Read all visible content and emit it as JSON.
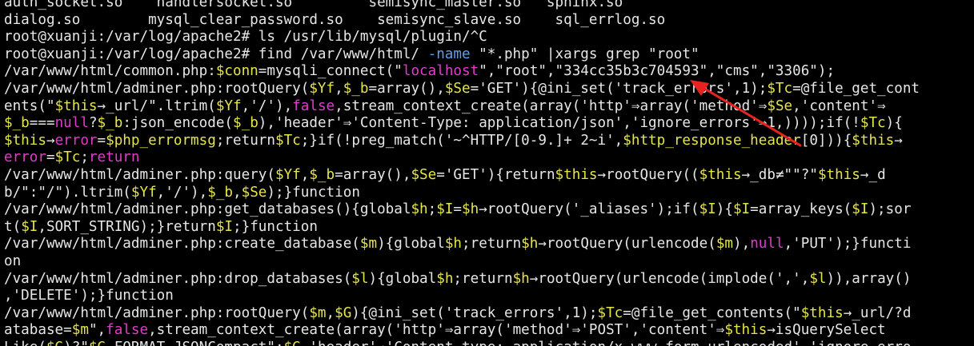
{
  "terminal": {
    "lines": [
      [
        [
          "auth_socket.so    handlersocket.so         semisync_master.so   sphinx.so",
          ""
        ]
      ],
      [
        [
          "dialog.so        mysql_clear_password.so    semisync_slave.so    sql_errlog.so",
          ""
        ]
      ],
      [
        [
          "root@xuanji:/var/log/apache2# ls /usr/lib/mysql/plugin/^C",
          ""
        ]
      ],
      [
        [
          "root@xuanji:/var/log/apache2# find /var/www/html/ ",
          ""
        ],
        [
          "-name",
          "opt"
        ],
        [
          " \"*.php\" |xargs grep \"root\"",
          ""
        ]
      ],
      [
        [
          "/var/www/html/common.php:",
          ""
        ],
        [
          "$conn",
          "var"
        ],
        [
          "=mysqli_connect(\"",
          ""
        ],
        [
          "localhost",
          "mag"
        ],
        [
          "\",\"root\",\"334cc35b3c704593\",\"cms\",\"3306\");",
          ""
        ]
      ],
      [
        [
          "/var/www/html/adminer.php:rootQuery(",
          ""
        ],
        [
          "$Yf",
          "var"
        ],
        [
          ",",
          ""
        ],
        [
          "$_b",
          "var"
        ],
        [
          "=array(),",
          ""
        ],
        [
          "$Se",
          "var"
        ],
        [
          "='GET'){@ini_set('track_errors',1);",
          ""
        ],
        [
          "$Tc",
          "var"
        ],
        [
          "=@file_get_cont",
          ""
        ]
      ],
      [
        [
          "ents(\"",
          ""
        ],
        [
          "$this",
          "var"
        ],
        [
          "→_url/\".ltrim(",
          ""
        ],
        [
          "$Yf",
          "var"
        ],
        [
          ",'/'),",
          ""
        ],
        [
          "false",
          "mag"
        ],
        [
          ",stream_context_create(array('http'⇒array('method'⇒",
          ""
        ],
        [
          "$Se",
          "var"
        ],
        [
          ",'content'⇒",
          ""
        ]
      ],
      [
        [
          "$_b",
          "var"
        ],
        [
          "===",
          ""
        ],
        [
          "null",
          "mag"
        ],
        [
          "?",
          ""
        ],
        [
          "$_b",
          "var"
        ],
        [
          ":json_encode(",
          ""
        ],
        [
          "$_b",
          "var"
        ],
        [
          "),'header'⇒'Content-Type: application/json','ignore_errors'⇒1,))));if(!",
          ""
        ],
        [
          "$Tc",
          "var"
        ],
        [
          "){",
          ""
        ]
      ],
      [
        [
          "$this",
          "var"
        ],
        [
          "→",
          ""
        ],
        [
          "error",
          "mag"
        ],
        [
          "=",
          ""
        ],
        [
          "$php_errormsg",
          "var"
        ],
        [
          ";return",
          ""
        ],
        [
          "$Tc",
          "var"
        ],
        [
          ";}if(!preg_match('~^HTTP/[0-9.]+ 2~i',",
          ""
        ],
        [
          "$http_response_header",
          "var"
        ],
        [
          "[0])){",
          ""
        ],
        [
          "$this",
          "var"
        ],
        [
          "→",
          ""
        ]
      ],
      [
        [
          "error",
          "mag"
        ],
        [
          "=",
          ""
        ],
        [
          "$Tc",
          "var"
        ],
        [
          ";",
          ""
        ],
        [
          "return",
          "mag"
        ]
      ],
      [
        [
          "/var/www/html/adminer.php:query(",
          ""
        ],
        [
          "$Yf",
          "var"
        ],
        [
          ",",
          ""
        ],
        [
          "$_b",
          "var"
        ],
        [
          "=array(),",
          ""
        ],
        [
          "$Se",
          "var"
        ],
        [
          "='GET'){return",
          ""
        ],
        [
          "$this",
          "var"
        ],
        [
          "→rootQuery((",
          ""
        ],
        [
          "$this",
          "var"
        ],
        [
          "→_db≠\"\"?\"",
          ""
        ],
        [
          "$this",
          "var"
        ],
        [
          "→_d",
          ""
        ]
      ],
      [
        [
          "b/\":\"/\").ltrim(",
          ""
        ],
        [
          "$Yf",
          "var"
        ],
        [
          ",'/'),",
          ""
        ],
        [
          "$_b",
          "var"
        ],
        [
          ",",
          ""
        ],
        [
          "$Se",
          "var"
        ],
        [
          ");}function",
          ""
        ]
      ],
      [
        [
          "/var/www/html/adminer.php:get_databases(){global",
          ""
        ],
        [
          "$h",
          "var"
        ],
        [
          ";",
          ""
        ],
        [
          "$I",
          "var"
        ],
        [
          "=",
          ""
        ],
        [
          "$h",
          "var"
        ],
        [
          "→rootQuery('_aliases');if(",
          ""
        ],
        [
          "$I",
          "var"
        ],
        [
          "){",
          ""
        ],
        [
          "$I",
          "var"
        ],
        [
          "=array_keys(",
          ""
        ],
        [
          "$I",
          "var"
        ],
        [
          ");sor",
          ""
        ]
      ],
      [
        [
          "t(",
          ""
        ],
        [
          "$I",
          "var"
        ],
        [
          ",SORT_STRING);}return",
          ""
        ],
        [
          "$I",
          "var"
        ],
        [
          ";}function",
          ""
        ]
      ],
      [
        [
          "/var/www/html/adminer.php:create_database(",
          ""
        ],
        [
          "$m",
          "var"
        ],
        [
          "){global",
          ""
        ],
        [
          "$h",
          "var"
        ],
        [
          ";return",
          ""
        ],
        [
          "$h",
          "var"
        ],
        [
          "→rootQuery(urlencode(",
          ""
        ],
        [
          "$m",
          "var"
        ],
        [
          "),",
          ""
        ],
        [
          "null",
          "mag"
        ],
        [
          ",'PUT');}functi",
          ""
        ]
      ],
      [
        [
          "on",
          ""
        ]
      ],
      [
        [
          "/var/www/html/adminer.php:drop_databases(",
          ""
        ],
        [
          "$l",
          "var"
        ],
        [
          "){global",
          ""
        ],
        [
          "$h",
          "var"
        ],
        [
          ";return",
          ""
        ],
        [
          "$h",
          "var"
        ],
        [
          "→rootQuery(urlencode(implode(',',",
          ""
        ],
        [
          "$l",
          "var"
        ],
        [
          ")),array()",
          ""
        ]
      ],
      [
        [
          ",'DELETE');}function",
          ""
        ]
      ],
      [
        [
          "/var/www/html/adminer.php:rootQuery(",
          ""
        ],
        [
          "$m",
          "var"
        ],
        [
          ",",
          ""
        ],
        [
          "$G",
          "var"
        ],
        [
          "){@ini_set('track_errors',1);",
          ""
        ],
        [
          "$Tc",
          "var"
        ],
        [
          "=@file_get_contents(\"",
          ""
        ],
        [
          "$this",
          "var"
        ],
        [
          "→_url/?d",
          ""
        ]
      ],
      [
        [
          "atabase=",
          ""
        ],
        [
          "$m",
          "var"
        ],
        [
          "\",",
          ""
        ],
        [
          "false",
          "mag"
        ],
        [
          ",stream_context_create(array('http'⇒array('method'⇒'POST','content'⇒",
          ""
        ],
        [
          "$this",
          "var"
        ],
        [
          "→isQuerySelect",
          ""
        ]
      ],
      [
        [
          "Like(",
          ""
        ],
        [
          "$G",
          "var"
        ],
        [
          ")?\"",
          ""
        ],
        [
          "$G",
          "var"
        ],
        [
          "_FORMAT_JSONCompact\":",
          ""
        ],
        [
          "$G",
          "var"
        ],
        [
          ",'header'⇒'Content-type: application/x-www-form-urlencoded','ignore_erro",
          ""
        ]
      ]
    ]
  },
  "colors": {
    "background": "#000000",
    "foreground": "#e6e6e6",
    "variable": "#e4e44b",
    "keyword": "#e03ccc",
    "option": "#5aa0f0",
    "annotation_arrow": "#e8231f"
  }
}
